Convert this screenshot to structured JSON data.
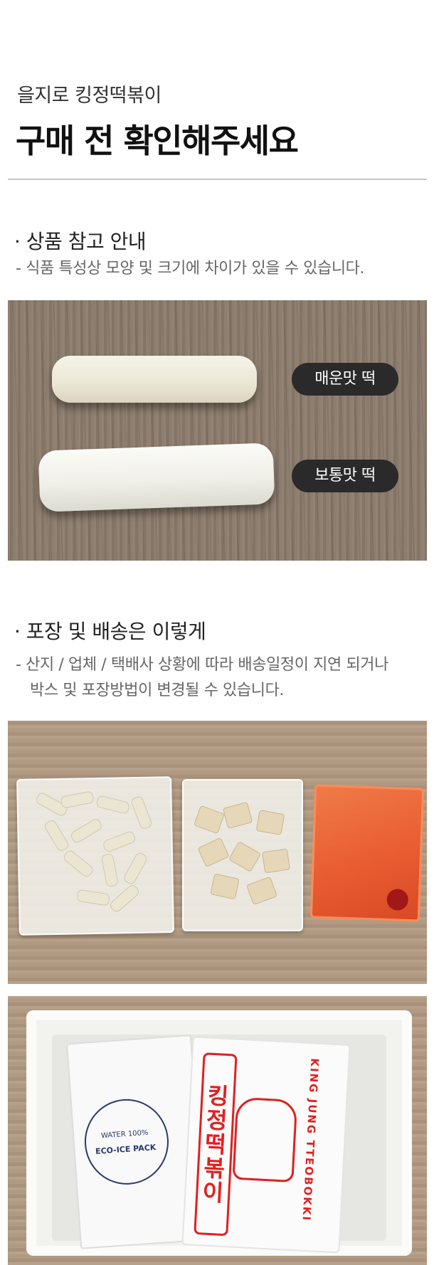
{
  "header": {
    "subtitle": "을지로 킹정떡볶이",
    "title": "구매 전 확인해주세요"
  },
  "section1": {
    "heading": "· 상품 참고 안내",
    "note": "- 식품 특성상 모양 및 크기에 차이가 있을 수 있습니다.",
    "badges": [
      "매운맛 떡",
      "보통맛 떡"
    ]
  },
  "section2": {
    "heading": "· 포장 및 배송은 이렇게",
    "note_line1": "- 산지 / 업체 / 택배사 상황에 따라 배송일정이 지연 되거나",
    "note_line2": "박스 및 포장방법이 변경될 수 있습니다."
  },
  "box_photo": {
    "ice_pack_line1": "WATER 100%",
    "ice_pack_line2": "ECO-ICE PACK",
    "brand_korean": "킹정떡볶이",
    "brand_roman": "KING JUNG TTEOBOKKI"
  }
}
